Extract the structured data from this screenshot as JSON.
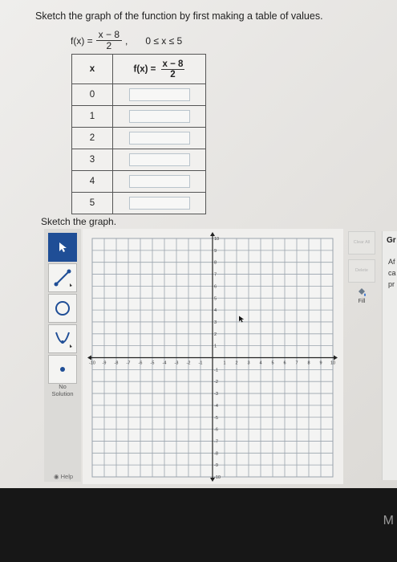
{
  "prompt": "Sketch the graph of the function by first making a table of values.",
  "function": {
    "lhs": "f(x) =",
    "numerator": "x − 8",
    "denominator": "2",
    "domain": "0 ≤ x ≤ 5"
  },
  "table": {
    "x_header": "x",
    "f_header_lhs": "f(x) =",
    "f_header_num": "x − 8",
    "f_header_den": "2",
    "x_values": [
      "0",
      "1",
      "2",
      "3",
      "4",
      "5"
    ]
  },
  "sketch_label": "Sketch the graph.",
  "tools": {
    "pointer": "pointer-tool",
    "line": "line-tool",
    "circle": "circle-tool",
    "parabola": "parabola-tool",
    "point": "point-tool",
    "no_solution": "No Solution",
    "help": "Help"
  },
  "side_buttons": {
    "clear_all": "Clear All",
    "delete": "Delete",
    "fill": "Fill"
  },
  "right_panel": {
    "title": "Gr",
    "line1": "Af",
    "line2": "ca",
    "line3": "pr"
  },
  "graph": {
    "x_min": -10,
    "x_max": 10,
    "y_min": -10,
    "y_max": 10,
    "x_ticks": [
      "-10",
      "-9",
      "-8",
      "-7",
      "-6",
      "-5",
      "-4",
      "-3",
      "-2",
      "-1",
      "1",
      "2",
      "3",
      "4",
      "5",
      "6",
      "7",
      "8",
      "9",
      "10"
    ],
    "y_ticks": [
      "10",
      "9",
      "8",
      "7",
      "6",
      "5",
      "4",
      "3",
      "2",
      "1",
      "-1",
      "-2",
      "-3",
      "-4",
      "-5",
      "-6",
      "-7",
      "-8",
      "-9",
      "-10"
    ],
    "grid_color": "#9aa3ad",
    "axis_color": "#222222"
  },
  "bottom_glyph": "M",
  "colors": {
    "active_tool": "#1f4e96"
  }
}
